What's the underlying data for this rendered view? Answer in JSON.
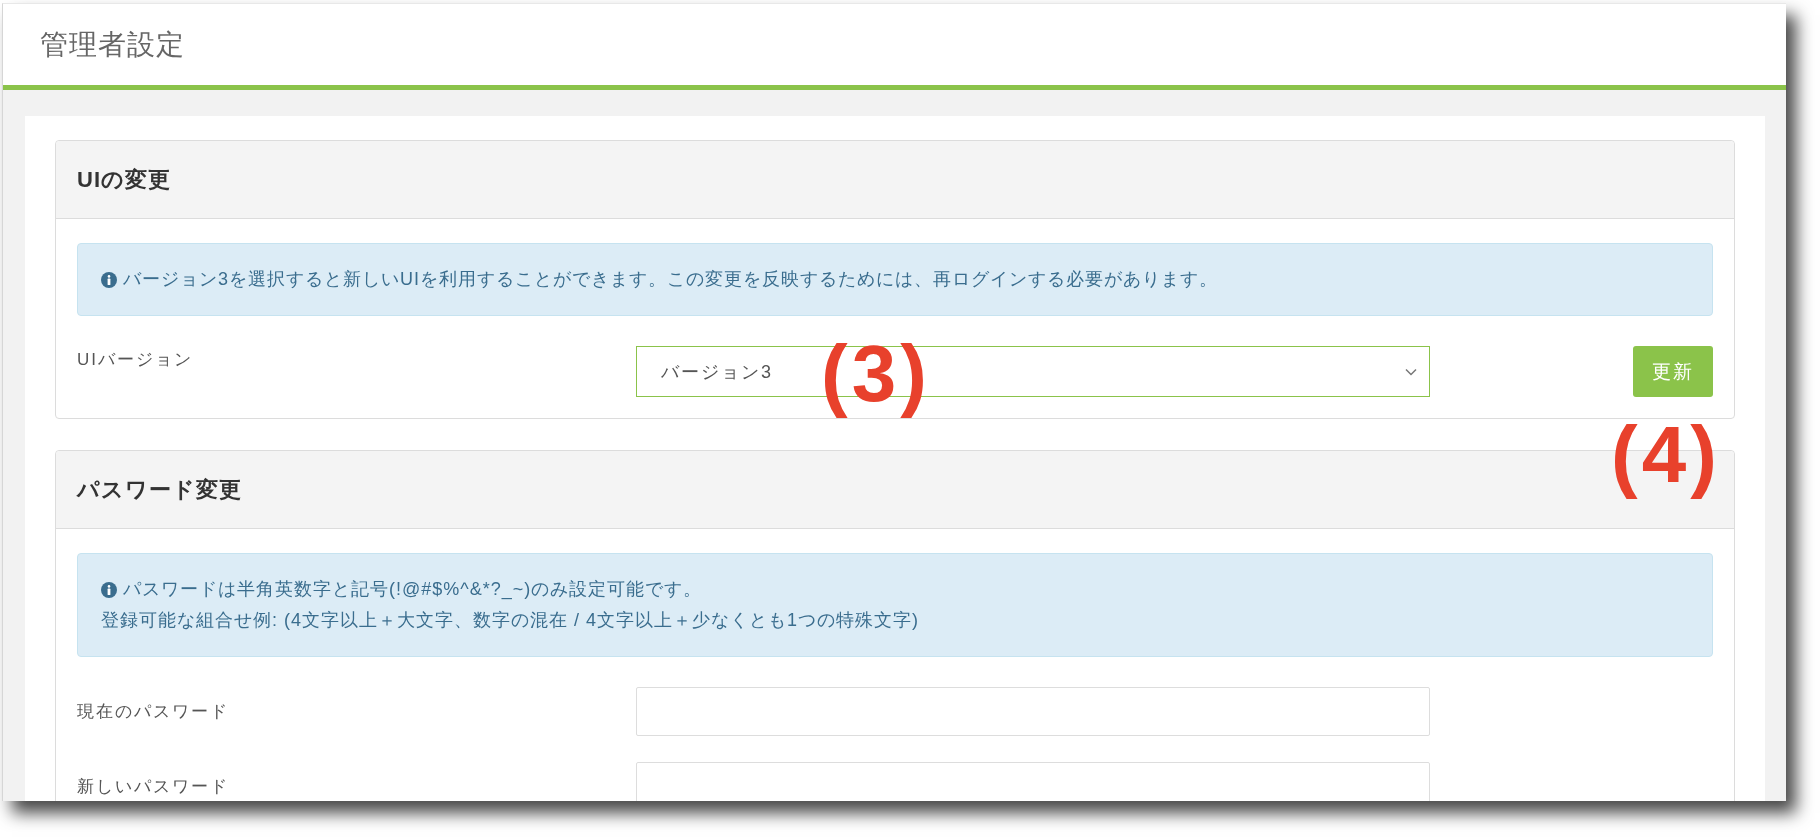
{
  "page_title": "管理者設定",
  "panels": [
    {
      "title": "UIの変更",
      "notice": [
        "バージョン3を選択すると新しいUIを利用することができます。この変更を反映するためには、再ログインする必要があります。"
      ],
      "fields": [
        {
          "kind": "select",
          "label": "UIバージョン",
          "value": "バージョン3",
          "focused": true
        }
      ],
      "button": "更新"
    },
    {
      "title": "パスワード変更",
      "notice": [
        "パスワードは半角英数字と記号(!@#$%^&*?_~)のみ設定可能です。",
        "登録可能な組合せ例: (4文字以上＋大文字、数字の混在 / 4文字以上＋少なくとも1つの特殊文字)"
      ],
      "fields": [
        {
          "kind": "password",
          "label": "現在のパスワード",
          "focused": false
        },
        {
          "kind": "password",
          "label": "新しいパスワード",
          "focused": false
        }
      ]
    }
  ],
  "annotations": [
    "(3)",
    "(4)"
  ]
}
